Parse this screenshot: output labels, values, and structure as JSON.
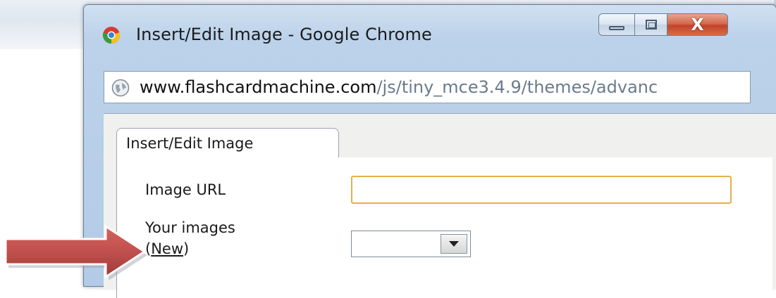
{
  "window": {
    "title": "Insert/Edit Image - Google Chrome",
    "close_glyph": "X"
  },
  "urlbar": {
    "host": "www.flashcardmachine.com",
    "path": "/js/tiny_mce3.4.9/themes/advanc"
  },
  "dialog": {
    "tab_label": "Insert/Edit Image",
    "image_url_label": "Image URL",
    "image_url_value": "",
    "your_images_label": "Your images",
    "new_link_prefix": "(",
    "new_link_text": "New",
    "new_link_suffix": ")",
    "your_images_selected": ""
  },
  "icons": {
    "app": "chrome-logo-icon",
    "site": "globe-icon",
    "window_controls": [
      "minimize-icon",
      "maximize-icon",
      "close-icon"
    ],
    "dropdown": "chevron-down-icon",
    "annotation": "red-arrow-icon"
  },
  "colors": {
    "annotation_arrow": "#c0504d",
    "input_focus_border": "#e2b04a",
    "close_button": "#c2442a"
  }
}
